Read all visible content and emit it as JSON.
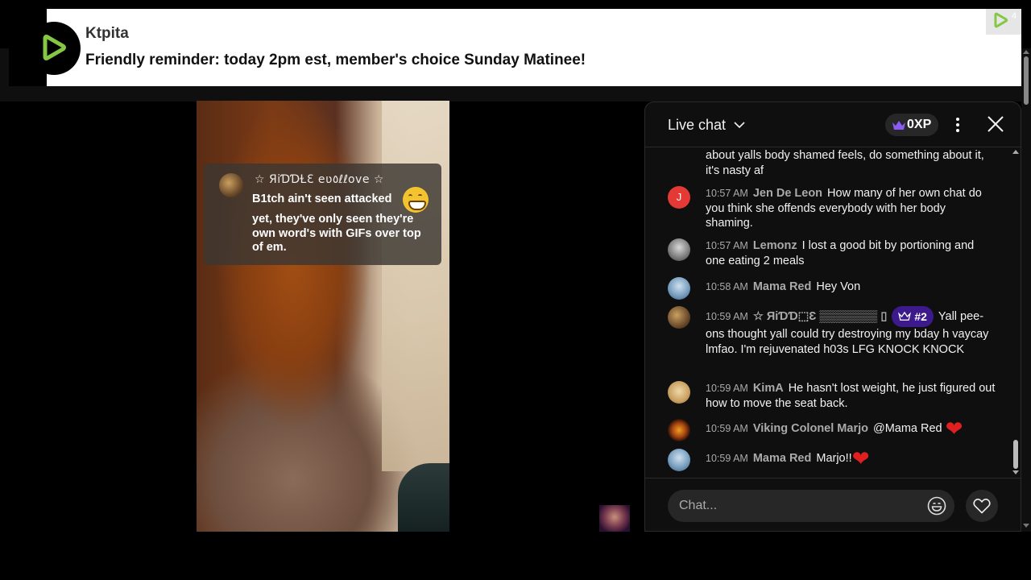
{
  "notification": {
    "channel_name": "Ktpita",
    "message": "Friendly reminder: today 2pm est, member's choice Sunday Matinee!",
    "logo_icon": "rumble-play-icon",
    "corner_count": "4",
    "accent": "#85c742"
  },
  "video_overlay": {
    "author": "☆ ЯiƊƊⱢƐ eʋ٥ℓℓove ☆",
    "line1": "B1tch ain't seen attacked",
    "line2": "yet, they've only seen they're own word's with GIFs over top of em."
  },
  "live_chat": {
    "title": "Live chat",
    "xp_label": "0XP",
    "input_placeholder": "Chat...",
    "messages": [
      {
        "time": "",
        "author": "",
        "text": "about yalls body shamed feels, do something about it, it's nasty af"
      },
      {
        "time": "10:57 AM",
        "author": "Jen De Leon",
        "avatar_initial": "J",
        "avatar_color": "#e53935",
        "text": "How many of her own chat do you think she offends everybody with her body shaming."
      },
      {
        "time": "10:57 AM",
        "author": "Lemonz",
        "text": "I lost a good bit by portioning and one eating 2 meals"
      },
      {
        "time": "10:58 AM",
        "author": "Mama Red",
        "text": "Hey Von"
      },
      {
        "time": "10:59 AM",
        "author": "☆ ЯiƊƊ⬚Ɛ ▒▒▒▒▒▒▒ ▯",
        "badge": "#2",
        "text": "Yall pee-ons thought yall could try destroying my bday h vaycay lmfao. I'm rejuvenated h03s LFG KNOCK KNOCK"
      },
      {
        "time": "10:59 AM",
        "author": "KimA",
        "text": "He hasn't lost weight, he just figured out how to move the seat back."
      },
      {
        "time": "10:59 AM",
        "author": "Viking Colonel Marjo",
        "text": "@Mama Red"
      },
      {
        "time": "10:59 AM",
        "author": "Mama Red",
        "text": "Marjo!!"
      }
    ]
  }
}
